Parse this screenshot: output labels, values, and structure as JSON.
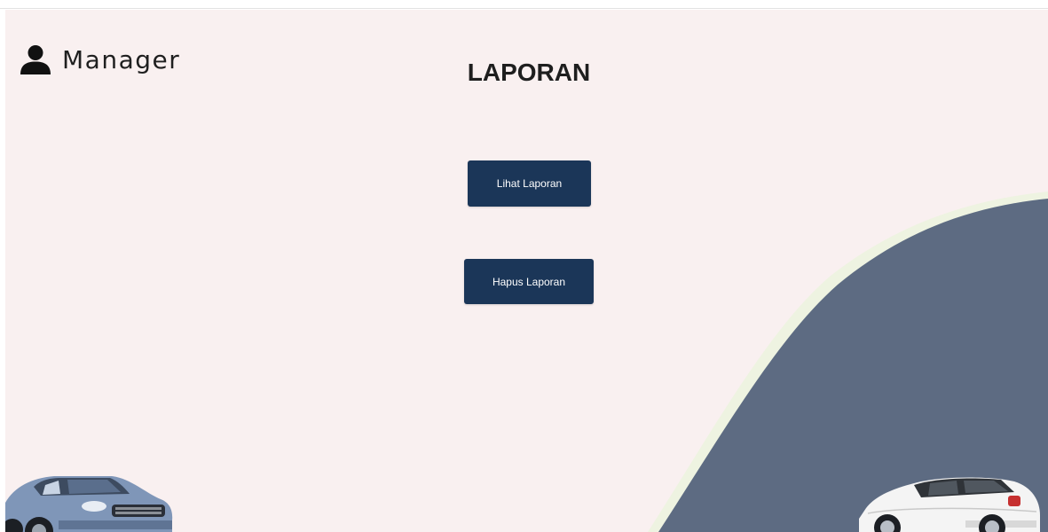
{
  "header": {
    "user_role": "Manager",
    "user_icon": "user-icon"
  },
  "main": {
    "title": "LAPORAN",
    "buttons": {
      "view_report": "Lihat Laporan",
      "delete_report": "Hapus Laporan"
    }
  },
  "colors": {
    "background": "#f9f0f0",
    "wave": "#5d6b82",
    "wave_edge": "#eef3e1",
    "button": "#1b3658",
    "button_text": "#ffffff",
    "text": "#1e1e1e"
  },
  "decorations": {
    "left_car": "blue-suv-car",
    "right_car": "white-suv-car"
  }
}
